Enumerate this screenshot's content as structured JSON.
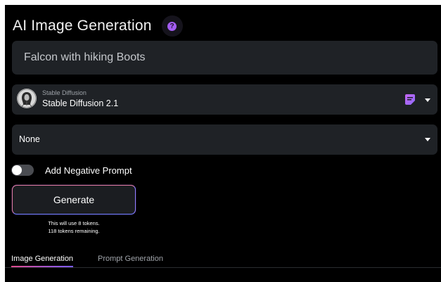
{
  "header": {
    "title": "AI Image Generation",
    "help_icon": "help-icon",
    "help_glyph": "?"
  },
  "prompt": {
    "value": "",
    "placeholder": "Falcon with hiking Boots"
  },
  "model": {
    "provider": "Stable Diffusion",
    "name": "Stable Diffusion 2.1"
  },
  "style": {
    "selected": "None"
  },
  "negative_prompt": {
    "label": "Add Negative Prompt",
    "enabled": false
  },
  "generate": {
    "label": "Generate",
    "tokens_line1": "This will use 8 tokens.",
    "tokens_line2": "118 tokens remaining."
  },
  "tabs": [
    {
      "label": "Image Generation",
      "active": true
    },
    {
      "label": "Prompt Generation",
      "active": false
    }
  ],
  "colors": {
    "accent": "#a35cf2",
    "panel_bg": "#000000",
    "field_bg": "#1f2226"
  }
}
